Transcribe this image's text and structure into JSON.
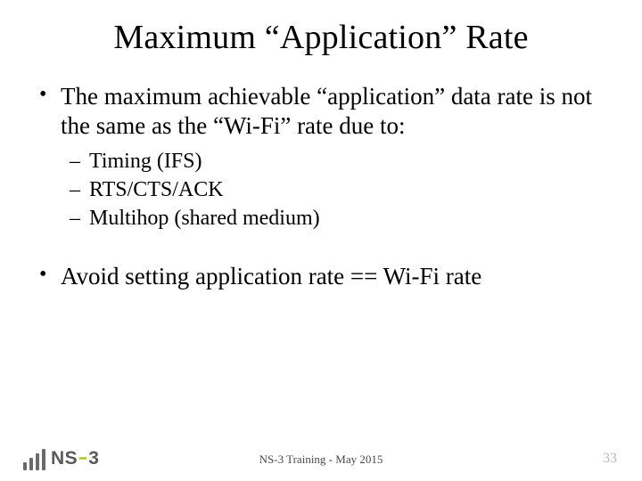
{
  "title": "Maximum “Application” Rate",
  "bullets": {
    "b1": "The maximum achievable “application” data rate is not the same as the “Wi-Fi” rate due to:",
    "sub1": "Timing (IFS)",
    "sub2": "RTS/CTS/ACK",
    "sub3": "Multihop (shared medium)",
    "b2": "Avoid setting application rate == Wi-Fi rate"
  },
  "footer": "NS-3 Training - May 2015",
  "page": "33",
  "logo": {
    "ns": "NS",
    "three": "3"
  }
}
